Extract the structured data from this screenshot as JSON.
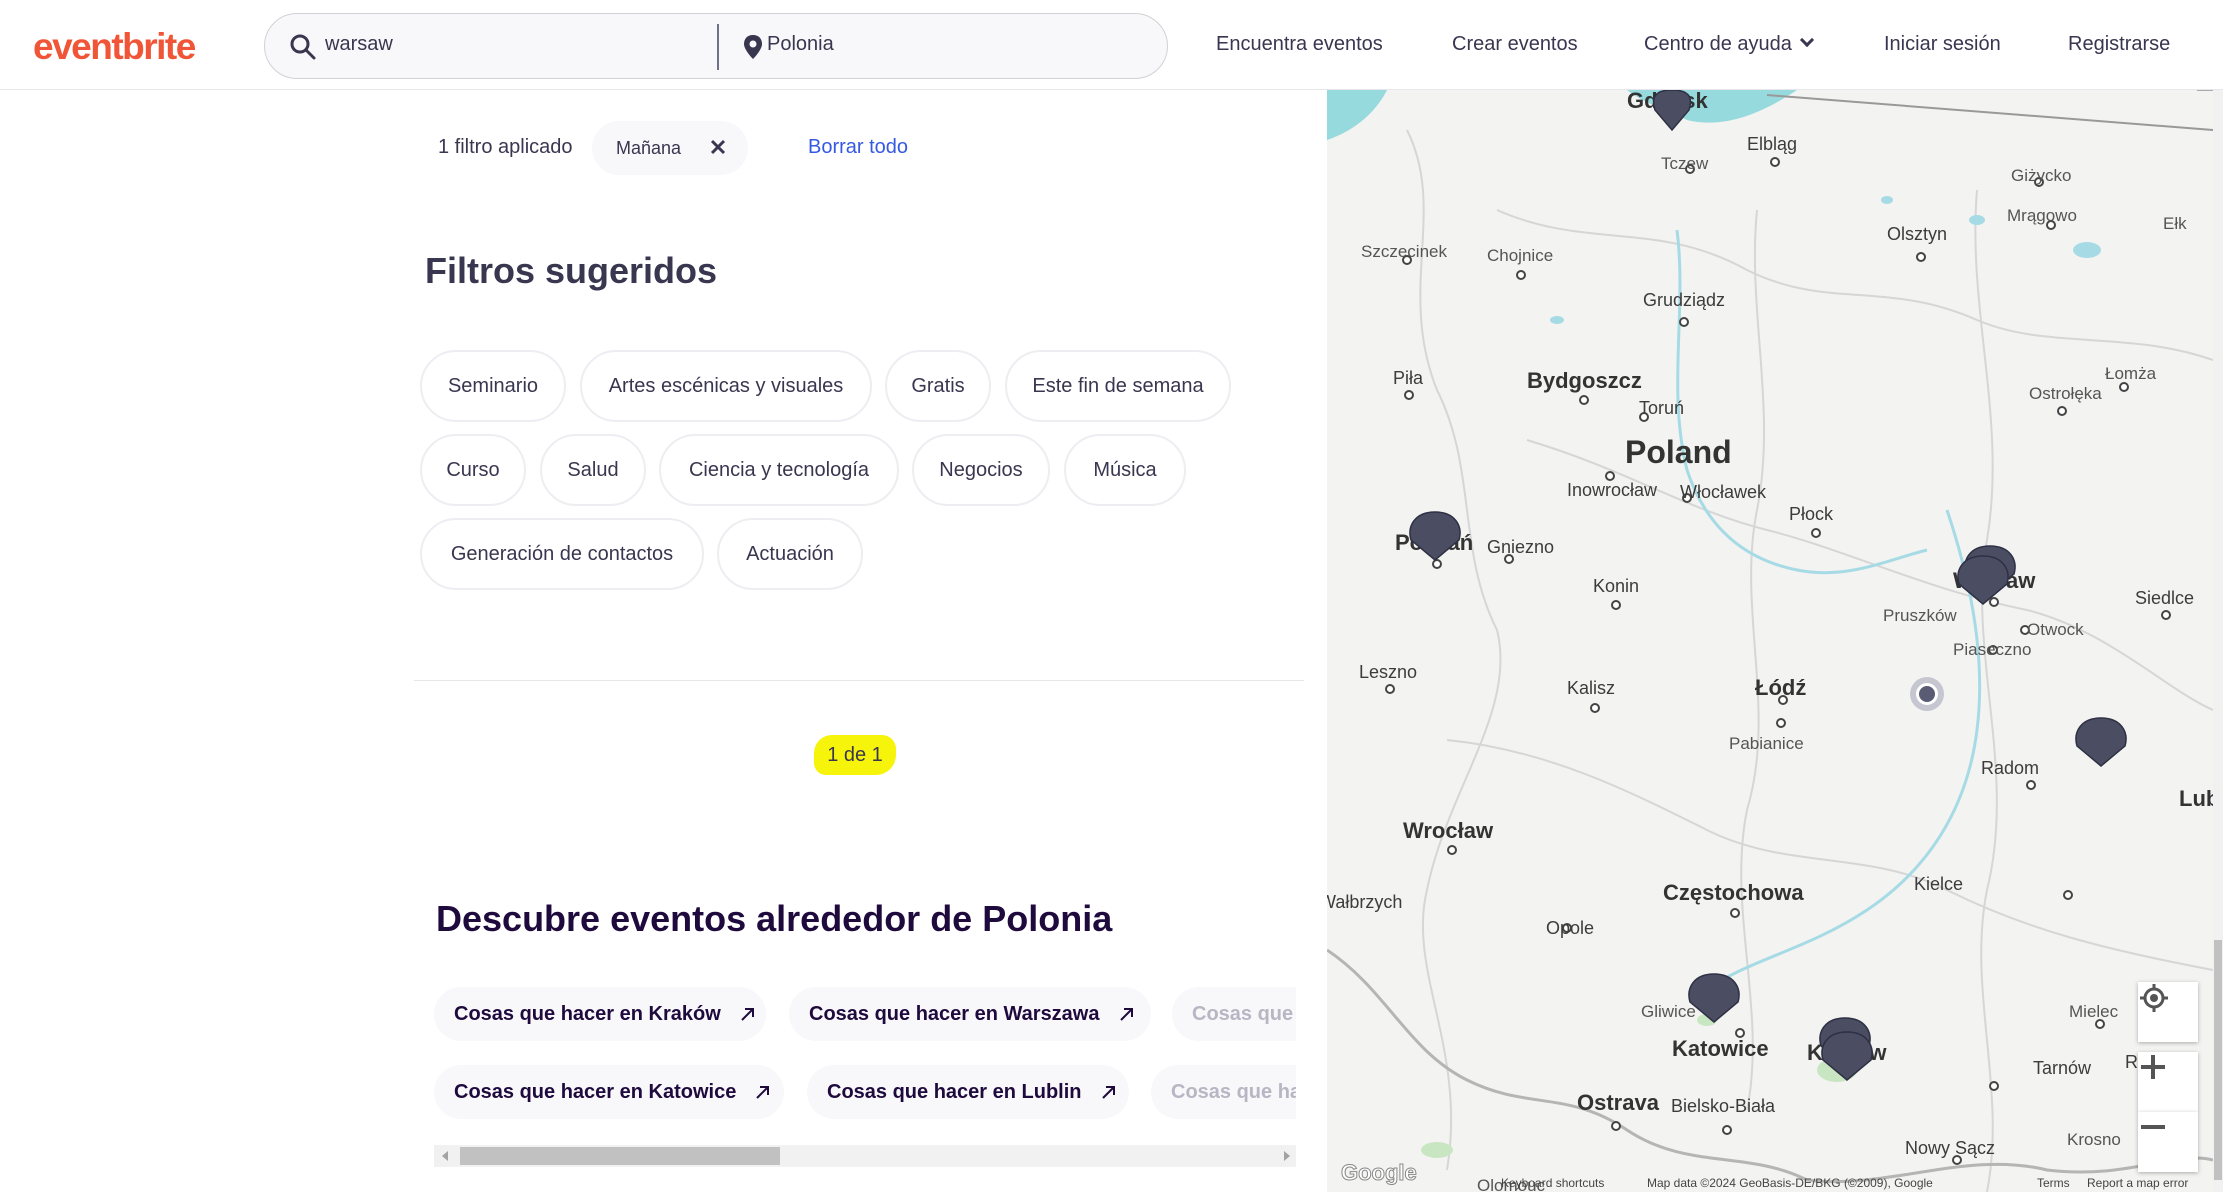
{
  "header": {
    "logo": "eventbrite",
    "search_query": "warsaw",
    "search_location": "Polonia",
    "nav": {
      "find_events": "Encuentra eventos",
      "create_events": "Crear eventos",
      "help_center": "Centro de ayuda",
      "login": "Iniciar sesión",
      "register": "Registrarse"
    }
  },
  "filters": {
    "applied_count": "1 filtro aplicado",
    "active_chip": "Mañana",
    "clear_all": "Borrar todo"
  },
  "suggested": {
    "title": "Filtros sugeridos",
    "items": [
      "Seminario",
      "Artes escénicas y visuales",
      "Gratis",
      "Este fin de semana",
      "Curso",
      "Salud",
      "Ciencia y tecnología",
      "Negocios",
      "Música",
      "Generación de contactos",
      "Actuación"
    ]
  },
  "pagination": "1 de 1",
  "discover": {
    "title": "Descubre eventos alrededor de Polonia",
    "row1": [
      "Cosas que hacer en Kraków",
      "Cosas que hacer en Warszawa",
      "Cosas que hacer en"
    ],
    "row2": [
      "Cosas que hacer en Katowice",
      "Cosas que hacer en Lublin",
      "Cosas que hacer en"
    ]
  },
  "map": {
    "country": "Poland",
    "cities": [
      "Gdańsk",
      "Elbląg",
      "Tczew",
      "Giżycko",
      "Mrągowo",
      "Olsztyn",
      "Ełk",
      "Szczecinek",
      "Chojnice",
      "Grudziądz",
      "Piła",
      "Bydgoszcz",
      "Toruń",
      "Łomża",
      "Ostrołęka",
      "Inowrocław",
      "Włocławek",
      "Płock",
      "Poznań",
      "Gniezno",
      "Konin",
      "Warsaw",
      "Pruszków",
      "Otwock",
      "Piaseczno",
      "Siedlce",
      "Leszno",
      "Kalisz",
      "Łódź",
      "Pabianice",
      "Radom",
      "Lublin",
      "Wrocław",
      "Częstochowa",
      "Kielce",
      "Opole",
      "Gliwice",
      "Katowice",
      "Kraków",
      "Mielec",
      "Tarnów",
      "Rzeszów",
      "Ostrava",
      "Bielsko-Biała",
      "Nowy Sącz",
      "Krosno",
      "Olomouc",
      "Wałbrzych"
    ],
    "footer": [
      "Keyboard shortcuts",
      "Map data ©2024 GeoBasis-DE/BKG (©2009), Google",
      "Terms",
      "Report a map error"
    ],
    "google": "Google"
  }
}
